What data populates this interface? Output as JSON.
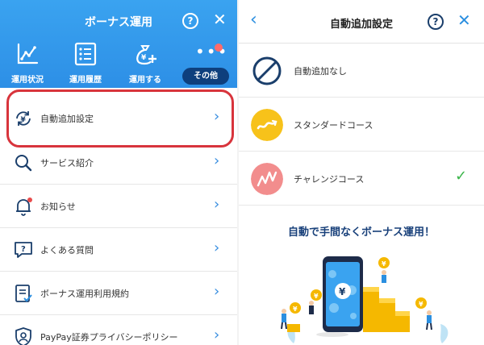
{
  "left": {
    "title": "ボーナス運用",
    "help": "?",
    "close": "✕",
    "nav": [
      {
        "label": "運用状況",
        "icon": "chart-icon"
      },
      {
        "label": "運用履歴",
        "icon": "list-icon"
      },
      {
        "label": "運用する",
        "icon": "money-bag-icon"
      },
      {
        "label": "その他",
        "icon": "more-icon"
      }
    ],
    "menu": [
      {
        "label": "自動追加設定",
        "icon": "auto-add-icon"
      },
      {
        "label": "サービス紹介",
        "icon": "search-icon"
      },
      {
        "label": "お知らせ",
        "icon": "bell-icon"
      },
      {
        "label": "よくある質問",
        "icon": "faq-icon"
      },
      {
        "label": "ボーナス運用利用規約",
        "icon": "terms-icon"
      },
      {
        "label": "PayPay証券プライバシーポリシー",
        "icon": "privacy-icon"
      }
    ],
    "chevron": "›"
  },
  "right": {
    "back": "‹",
    "title": "自動追加設定",
    "help": "?",
    "close": "✕",
    "options": [
      {
        "label": "自動追加なし",
        "icon": "no-icon",
        "selected": false
      },
      {
        "label": "スタンダードコース",
        "icon": "standard-trend-icon",
        "color": "#f7c21a",
        "selected": false
      },
      {
        "label": "チャレンジコース",
        "icon": "challenge-trend-icon",
        "color": "#f28d8d",
        "selected": true
      }
    ],
    "check": "✓",
    "promo": "自動で手間なくボーナス運用！"
  },
  "colors": {
    "header_blue": "#2d8fe6",
    "active_pill": "#0e3f7d",
    "highlight_red": "#d8343c",
    "accent_blue": "#2b8fe0",
    "check_green": "#3bb54a",
    "coin_gold": "#f5b800"
  }
}
